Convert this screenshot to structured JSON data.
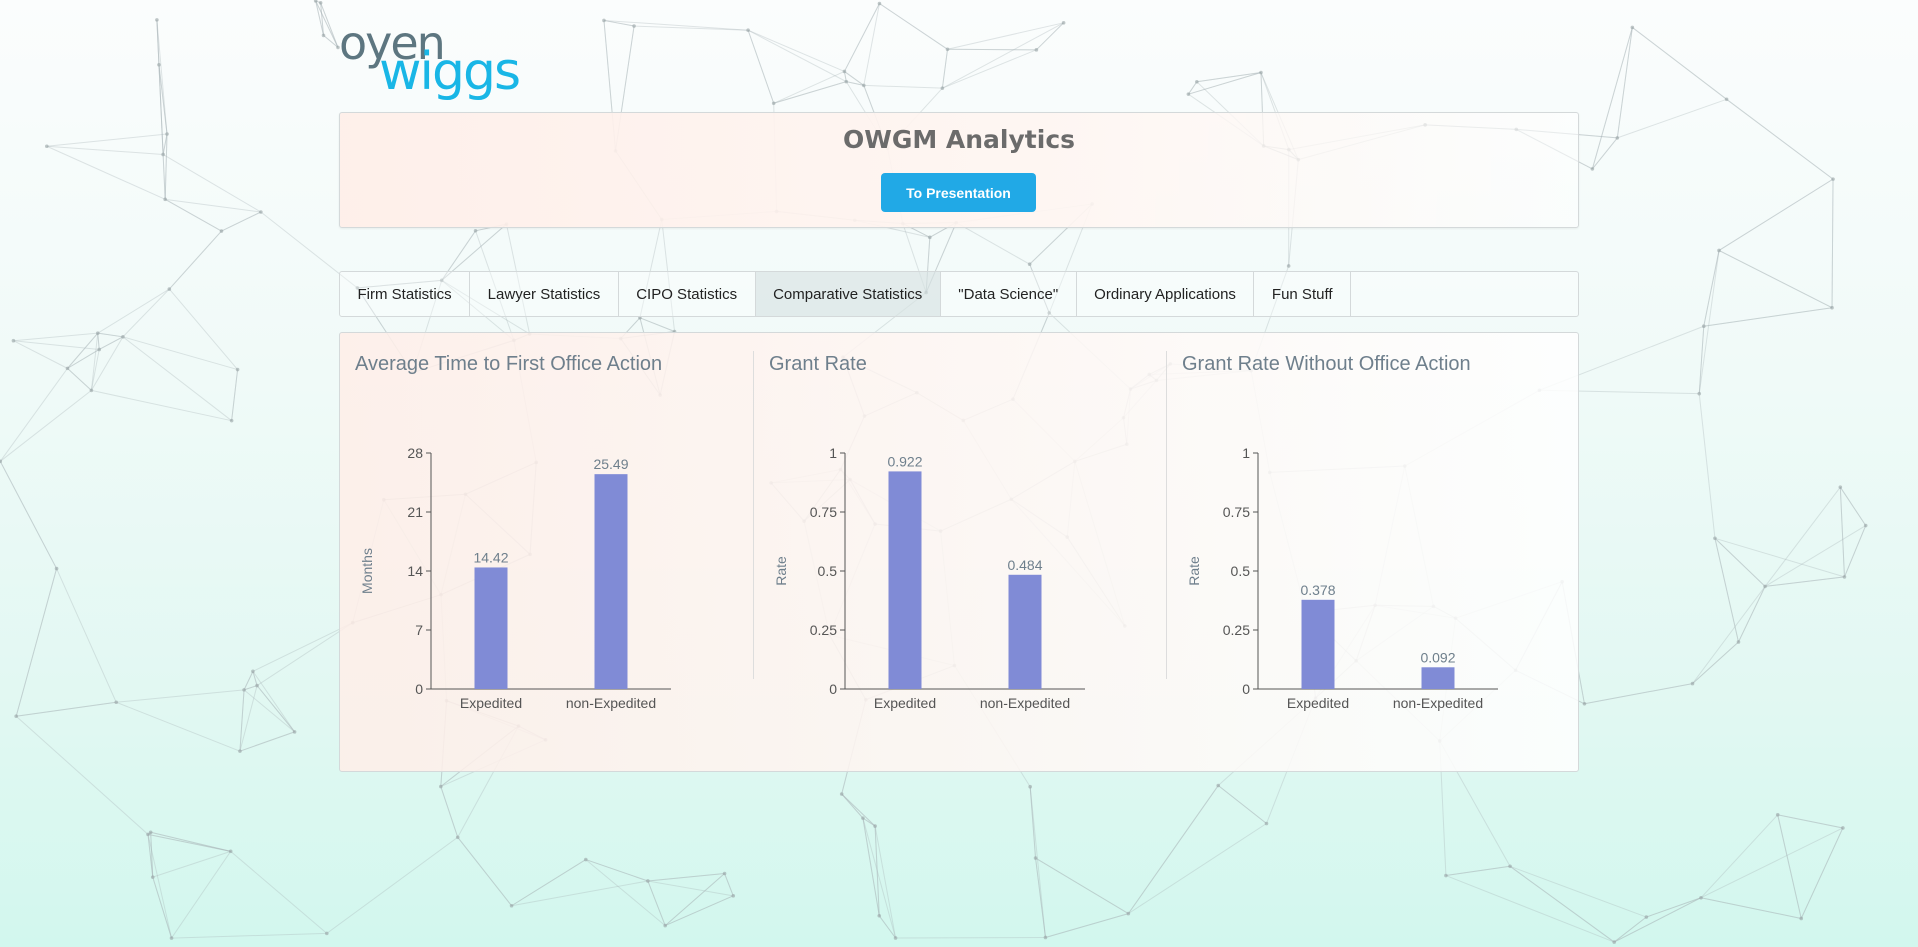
{
  "logo": {
    "line1": "oyen",
    "line2": "wiggs"
  },
  "header": {
    "title": "OWGM Analytics",
    "button_label": "To Presentation"
  },
  "tabs": [
    {
      "label": "Firm Statistics",
      "active": false
    },
    {
      "label": "Lawyer Statistics",
      "active": false
    },
    {
      "label": "CIPO Statistics",
      "active": false
    },
    {
      "label": "Comparative Statistics",
      "active": true
    },
    {
      "label": "\"Data Science\"",
      "active": false
    },
    {
      "label": "Ordinary Applications",
      "active": false
    },
    {
      "label": "Fun Stuff",
      "active": false
    }
  ],
  "colors": {
    "bar": "#808bd6",
    "accent": "#21a9e6",
    "logo_dark": "#5d7680",
    "logo_light": "#19b6e6"
  },
  "chart_data": [
    {
      "type": "bar",
      "title": "Average Time to First Office Action",
      "categories": [
        "Expedited",
        "non-Expedited"
      ],
      "values": [
        14.42,
        25.49
      ],
      "labels": [
        "14.42",
        "25.49"
      ],
      "ylabel": "Months",
      "ylim": [
        0,
        28
      ],
      "yticks": [
        0,
        7,
        14,
        21,
        28
      ],
      "ytick_labels": [
        "0",
        "7",
        "14",
        "21",
        "28"
      ]
    },
    {
      "type": "bar",
      "title": "Grant Rate",
      "categories": [
        "Expedited",
        "non-Expedited"
      ],
      "values": [
        0.922,
        0.484
      ],
      "labels": [
        "0.922",
        "0.484"
      ],
      "ylabel": "Rate",
      "ylim": [
        0,
        1
      ],
      "yticks": [
        0,
        0.25,
        0.5,
        0.75,
        1
      ],
      "ytick_labels": [
        "0",
        "0.25",
        "0.5",
        "0.75",
        "1"
      ]
    },
    {
      "type": "bar",
      "title": "Grant Rate Without Office Action",
      "categories": [
        "Expedited",
        "non-Expedited"
      ],
      "values": [
        0.378,
        0.092
      ],
      "labels": [
        "0.378",
        "0.092"
      ],
      "ylabel": "Rate",
      "ylim": [
        0,
        1
      ],
      "yticks": [
        0,
        0.25,
        0.5,
        0.75,
        1
      ],
      "ytick_labels": [
        "0",
        "0.25",
        "0.5",
        "0.75",
        "1"
      ]
    }
  ]
}
